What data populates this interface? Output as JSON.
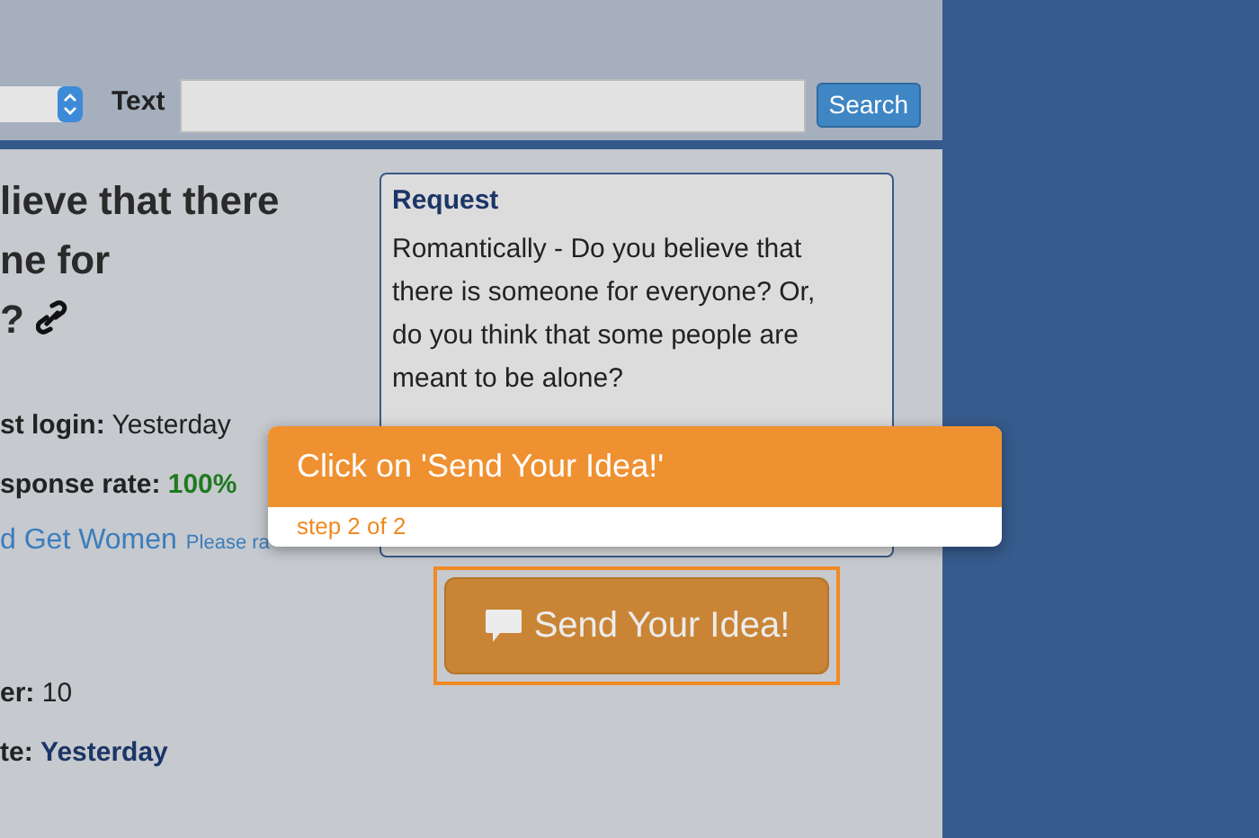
{
  "search_bar": {
    "label": "Text",
    "button": "Search"
  },
  "question": {
    "title_lines": [
      "lieve that there",
      "ne for",
      "?"
    ]
  },
  "stats": [
    {
      "label": "st login:",
      "value": "Yesterday",
      "kind": "plain"
    },
    {
      "label": "sponse rate:",
      "value": "100%",
      "kind": "good"
    }
  ],
  "rating": {
    "link": "d Get Women",
    "note": "Please ra"
  },
  "stats2": [
    {
      "label": "er:",
      "value": "10",
      "kind": "plain"
    },
    {
      "label": "te:",
      "value": "Yesterday",
      "kind": "strong"
    }
  ],
  "request": {
    "title": "Request",
    "body": "Romantically - Do you believe that there is someone for everyone? Or, do you think that some people are meant to be alone?"
  },
  "send_button": "Send Your Idea!",
  "tour": {
    "title": "Click on 'Send Your Idea!'",
    "step": "step 2 of 2"
  }
}
